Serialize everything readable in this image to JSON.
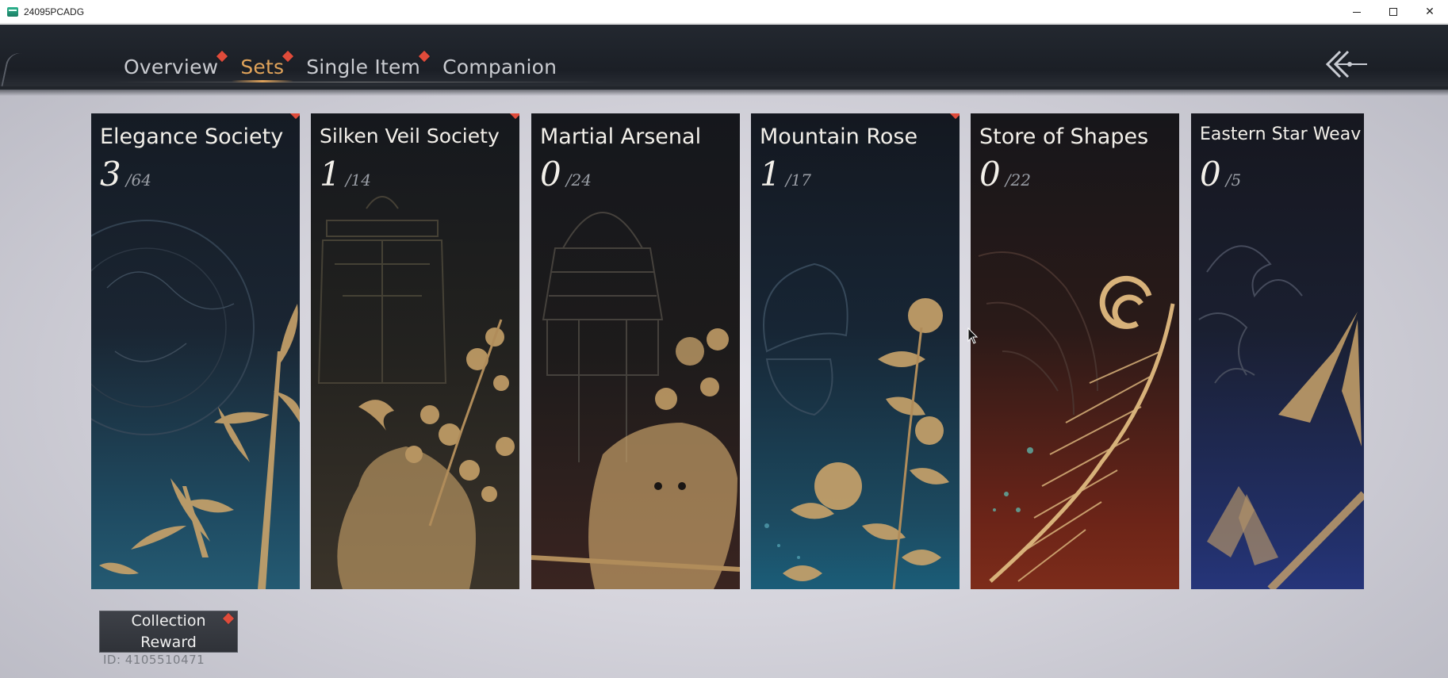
{
  "window": {
    "title": "24095PCADG",
    "minimize_icon": "minimize-icon",
    "maximize_icon": "maximize-icon",
    "close_icon": "close-icon",
    "close_glyph": "✕"
  },
  "nav": {
    "tabs": [
      {
        "label": "Overview",
        "active": false,
        "has_badge": true
      },
      {
        "label": "Sets",
        "active": true,
        "has_badge": true
      },
      {
        "label": "Single Item",
        "active": false,
        "has_badge": true
      },
      {
        "label": "Companion",
        "active": false,
        "has_badge": false
      }
    ],
    "back_icon": "double-chevron-left-icon"
  },
  "colors": {
    "accent": "#e0a35a",
    "badge": "#e04b3a",
    "card_text": "#f3f0ea",
    "art_gold": "#c9a36a"
  },
  "sets": [
    {
      "name": "Elegance Society",
      "owned": "3",
      "total": "/64",
      "has_badge": true,
      "art": "bamboo-and-orb"
    },
    {
      "name": "Silken Veil Society",
      "owned": "1",
      "total": "/14",
      "has_badge": true,
      "art": "bell-and-plum-blossom"
    },
    {
      "name": "Martial Arsenal",
      "owned": "0",
      "total": "/24",
      "has_badge": false,
      "art": "helmet-and-tiger"
    },
    {
      "name": "Mountain Rose",
      "owned": "1",
      "total": "/17",
      "has_badge": true,
      "art": "butterfly-and-roses"
    },
    {
      "name": "Store of Shapes",
      "owned": "0",
      "total": "/22",
      "has_badge": false,
      "art": "crane-and-swirl"
    },
    {
      "name": "Eastern Star Weav",
      "owned": "0",
      "total": "/5",
      "has_badge": false,
      "art": "cicada-and-cloud"
    }
  ],
  "reward": {
    "label": "Collection Reward",
    "has_badge": true
  },
  "user": {
    "id_text": "ID: 4105510471"
  }
}
